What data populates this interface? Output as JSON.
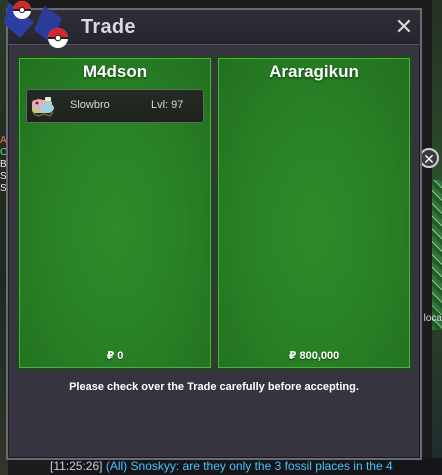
{
  "window": {
    "title": "Trade",
    "close_glyph": "✕"
  },
  "left_panel": {
    "player_name": "M4dson",
    "money": "₽ 0",
    "pokemon": [
      {
        "name": "Slowbro",
        "level": "Lvl: 97",
        "icon": "slowbro-icon"
      }
    ]
  },
  "right_panel": {
    "player_name": "Araragikun",
    "money": "₽ 800,000",
    "pokemon": []
  },
  "footer": {
    "note": "Please check over the Trade carefully before accepting."
  },
  "background": {
    "chat_time": "[11:25:26]",
    "chat_channel": "(All)",
    "chat_message": "Snoskyy: are they only the 3 fossil places in the 4",
    "side_close_glyph": "✕",
    "right_snippet": "loca"
  },
  "colors": {
    "panel_green": "#2a8226",
    "window_bg": "#36343f",
    "title_text": "#d9d8de"
  }
}
